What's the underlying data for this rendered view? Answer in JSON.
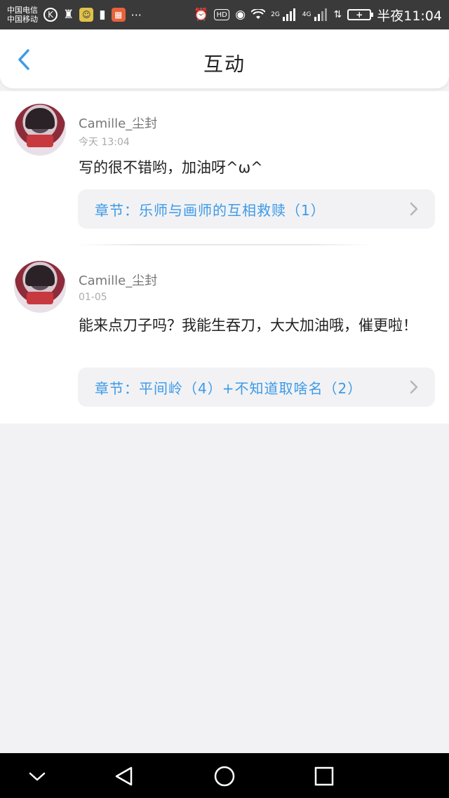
{
  "status_bar": {
    "carrier1": "中国电信",
    "carrier2": "中国移动",
    "more": "···",
    "net1": "2G",
    "net2": "4G",
    "battery": "+",
    "time": "半夜11:04"
  },
  "header": {
    "title": "互动"
  },
  "comments": [
    {
      "username": "Camille_尘封",
      "time": "今天 13:04",
      "content": "写的很不错哟，加油呀^ω^",
      "chapter": "章节：乐师与画师的互相救赎（1）"
    },
    {
      "username": "Camille_尘封",
      "time": "01-05",
      "content": "能来点刀子吗？我能生吞刀，大大加油哦，催更啦！",
      "chapter": "章节：平间岭（4）+不知道取啥名（2）"
    }
  ],
  "colors": {
    "accent": "#3c9ae8",
    "bg": "#f2f2f4"
  }
}
